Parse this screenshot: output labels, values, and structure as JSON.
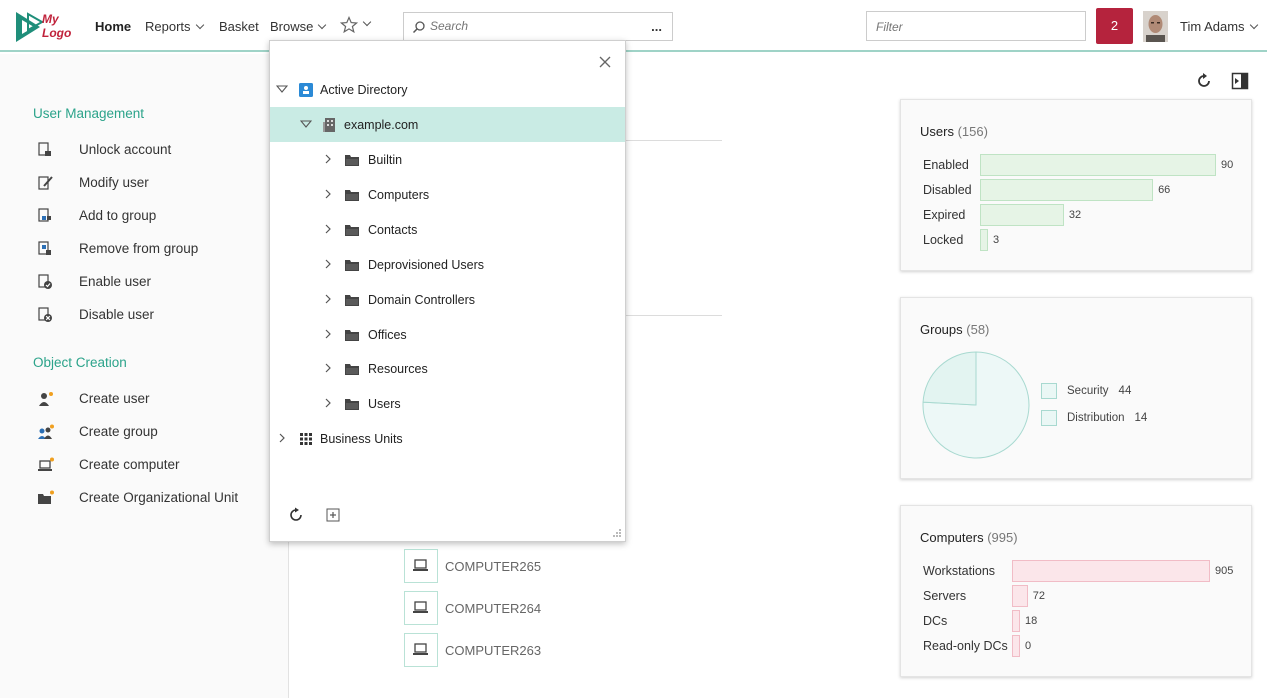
{
  "header": {
    "logo_line1": "My",
    "logo_line2": "Logo",
    "nav": {
      "home": "Home",
      "reports": "Reports",
      "basket": "Basket",
      "browse": "Browse"
    },
    "search_placeholder": "Search",
    "search_more": "...",
    "filter_placeholder": "Filter",
    "notification_count": "2",
    "user_name": "Tim Adams"
  },
  "sidebar": {
    "sections": [
      {
        "title": "User Management",
        "items": [
          {
            "label": "Unlock account",
            "icon": "unlock-account-icon"
          },
          {
            "label": "Modify user",
            "icon": "modify-user-icon"
          },
          {
            "label": "Add to group",
            "icon": "add-to-group-icon"
          },
          {
            "label": "Remove from group",
            "icon": "remove-from-group-icon"
          },
          {
            "label": "Enable user",
            "icon": "enable-user-icon"
          },
          {
            "label": "Disable user",
            "icon": "disable-user-icon"
          }
        ]
      },
      {
        "title": "Object Creation",
        "items": [
          {
            "label": "Create user",
            "icon": "create-user-icon"
          },
          {
            "label": "Create group",
            "icon": "create-group-icon"
          },
          {
            "label": "Create computer",
            "icon": "create-computer-icon"
          },
          {
            "label": "Create Organizational Unit",
            "icon": "create-ou-icon"
          }
        ]
      }
    ]
  },
  "main": {
    "computers": [
      "COMPUTER265",
      "COMPUTER264",
      "COMPUTER263"
    ]
  },
  "tree": {
    "root": "Active Directory",
    "domain": "example.com",
    "containers": [
      "Builtin",
      "Computers",
      "Contacts",
      "Deprovisioned Users",
      "Domain Controllers",
      "Offices",
      "Resources",
      "Users"
    ],
    "business_units": "Business Units"
  },
  "cards": {
    "users": {
      "title": "Users",
      "count": "(156)",
      "max": 90,
      "rows": [
        {
          "label": "Enabled",
          "value": 90
        },
        {
          "label": "Disabled",
          "value": 66
        },
        {
          "label": "Expired",
          "value": 32
        },
        {
          "label": "Locked",
          "value": 3
        }
      ]
    },
    "groups": {
      "title": "Groups",
      "count": "(58)",
      "slices": [
        {
          "label": "Security",
          "value": 44
        },
        {
          "label": "Distribution",
          "value": 14
        }
      ]
    },
    "computers": {
      "title": "Computers",
      "count": "(995)",
      "max": 905,
      "rows": [
        {
          "label": "Workstations",
          "value": 905
        },
        {
          "label": "Servers",
          "value": 72
        },
        {
          "label": "DCs",
          "value": 18
        },
        {
          "label": "Read-only DCs",
          "value": 0
        }
      ]
    }
  },
  "colors": {
    "accent": "#2ba38a",
    "notification": "#b5233d",
    "selected_row": "#c9ebe4",
    "users_bar_fill": "#e6f4e6",
    "users_bar_border": "#bfe3c4",
    "computers_bar_fill": "#fbe6ea",
    "computers_bar_border": "#f1bcc6",
    "groups_pie_fill": "#edf8f7",
    "groups_pie_border": "#a8d9d0"
  }
}
